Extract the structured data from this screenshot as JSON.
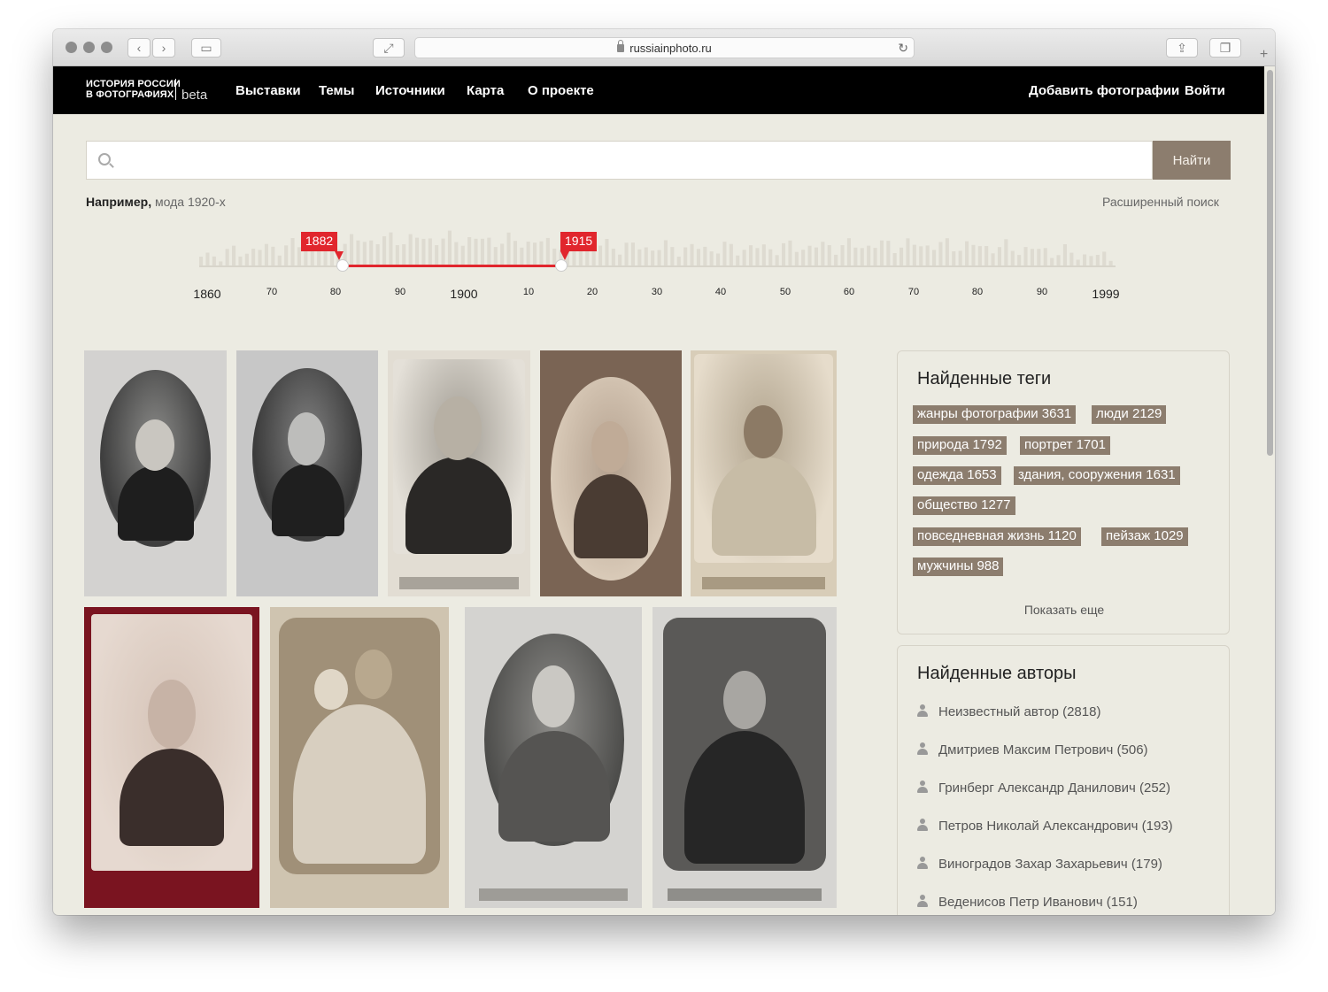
{
  "browser": {
    "url": "russiainphoto.ru",
    "back_icon": "chevron-left-icon",
    "forward_icon": "chevron-right-icon",
    "sidebar_icon": "sidebar-icon",
    "fullscreen_icon": "expand-icon",
    "reload_icon": "reload-icon",
    "share_icon": "share-icon",
    "tabs_icon": "tabs-icon",
    "plus": "+"
  },
  "header": {
    "logo_line1": "ИСТОРИЯ РОССИИ",
    "logo_line2": "В ФОТОГРАФИЯХ",
    "logo_beta": "beta",
    "nav": [
      "Выставки",
      "Темы",
      "Источники",
      "Карта",
      "О проекте"
    ],
    "add_photos": "Добавить фотографии",
    "login": "Войти"
  },
  "search": {
    "placeholder": "",
    "button": "Найти",
    "example_bold": "Например,",
    "example_text": " мода 1920-х",
    "advanced": "Расширенный поиск"
  },
  "timeline": {
    "range_from": "1882",
    "range_to": "1915",
    "labels": [
      "1860",
      "70",
      "80",
      "90",
      "1900",
      "10",
      "20",
      "30",
      "40",
      "50",
      "60",
      "70",
      "80",
      "90",
      "1999"
    ],
    "accent_color": "#e1262d"
  },
  "tags": {
    "title": "Найденные теги",
    "items": [
      "жанры фотографии 3631",
      "люди 2129",
      "природа 1792",
      "портрет 1701",
      "одежда 1653",
      "здания, сооружения 1631",
      "общество 1277",
      "повседневная жизнь 1120",
      "пейзаж 1029",
      "мужчины 988"
    ],
    "show_more": "Показать еще"
  },
  "authors": {
    "title": "Найденные авторы",
    "items": [
      "Неизвестный автор (2818)",
      "Дмитриев Максим Петрович (506)",
      "Гринберг Александр Данилович (252)",
      "Петров Николай Александрович (193)",
      "Виноградов Захар Захарьевич (179)",
      "Веденисов Петр Иванович (151)"
    ]
  },
  "colors": {
    "page_bg": "#ecebe2",
    "header_bg": "#000000",
    "tag_bg": "#8c7d6e",
    "button_bg": "#8c7d6e"
  }
}
